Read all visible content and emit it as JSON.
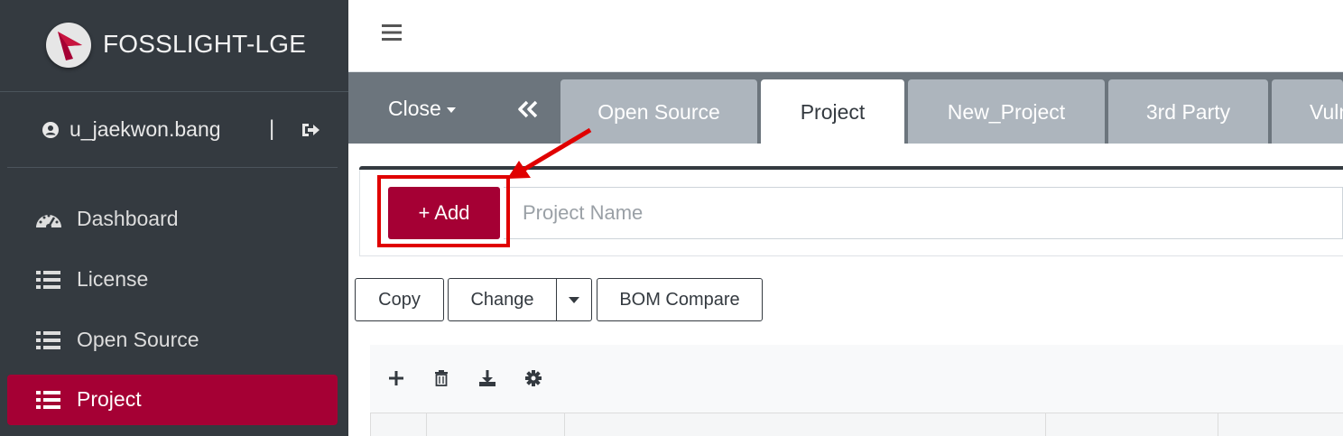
{
  "brand": {
    "name": "FOSSLIGHT-LGE"
  },
  "user": {
    "name": "u_jaekwon.bang",
    "separator": "|"
  },
  "sidebar": {
    "items": [
      {
        "label": "Dashboard",
        "icon": "dashboard-icon",
        "active": false
      },
      {
        "label": "License",
        "icon": "list-icon",
        "active": false
      },
      {
        "label": "Open Source",
        "icon": "list-icon",
        "active": false
      },
      {
        "label": "Project",
        "icon": "list-icon",
        "active": true
      }
    ]
  },
  "topbar": {
    "menu_icon": "hamburger-icon"
  },
  "tabbar": {
    "close_label": "Close",
    "collapse_icon": "double-chevron-left-icon",
    "tabs": [
      {
        "label": "Open Source",
        "active": false
      },
      {
        "label": "Project",
        "active": true
      },
      {
        "label": "New_Project",
        "active": false
      },
      {
        "label": "3rd Party",
        "active": false
      },
      {
        "label": "Vulnerability",
        "active": false
      }
    ]
  },
  "project_form": {
    "add_label": "+ Add",
    "name_placeholder": "Project Name"
  },
  "actions": {
    "copy_label": "Copy",
    "change_label": "Change",
    "bom_compare_label": "BOM Compare"
  },
  "grid_toolbar": [
    "plus-icon",
    "trash-icon",
    "download-icon",
    "gear-icon"
  ],
  "colors": {
    "sidebar_bg": "#343a40",
    "accent": "#a50034",
    "tabbar_bg": "#6c757d",
    "tab_inactive": "#adb5bd",
    "annotation_red": "#e00000"
  }
}
